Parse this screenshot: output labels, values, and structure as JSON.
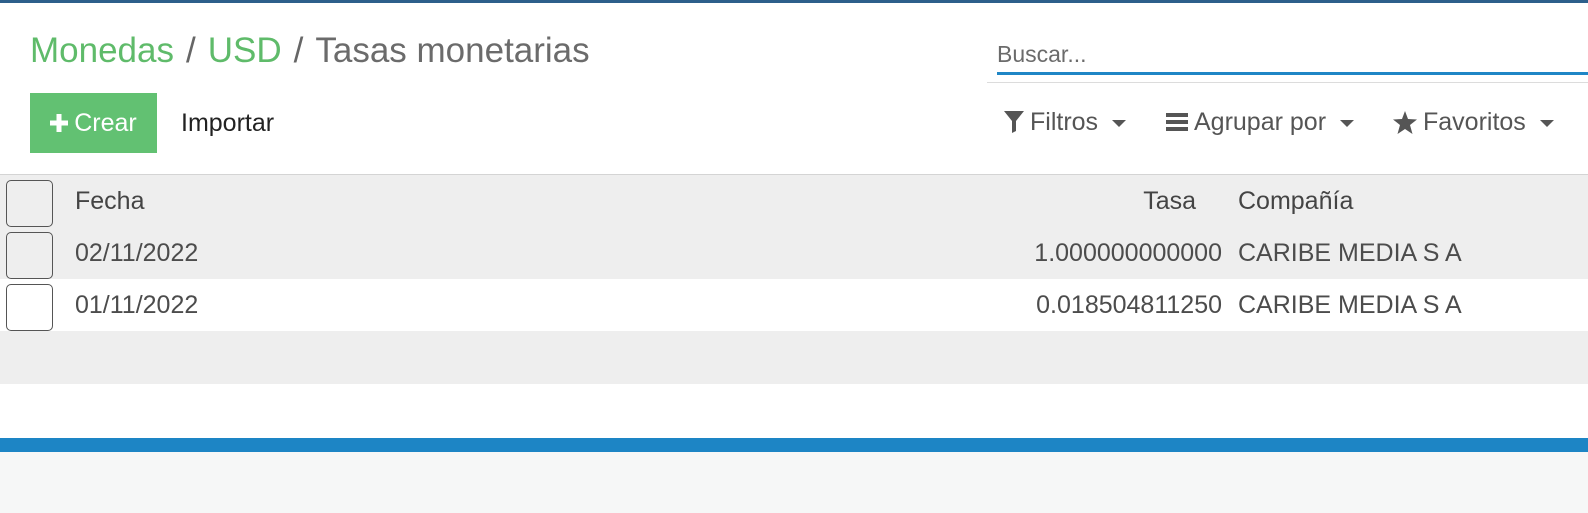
{
  "breadcrumb": {
    "items": [
      "Monedas",
      "USD"
    ],
    "separator": "/",
    "current": "Tasas monetarias"
  },
  "search": {
    "placeholder": "Buscar..."
  },
  "buttons": {
    "create": "Crear",
    "import": "Importar"
  },
  "filters": {
    "filtros": "Filtros",
    "agrupar": "Agrupar por",
    "favoritos": "Favoritos"
  },
  "table": {
    "columns": {
      "fecha": "Fecha",
      "tasa": "Tasa",
      "compania": "Compañía"
    },
    "rows": [
      {
        "fecha": "02/11/2022",
        "tasa": "1.000000000000",
        "compania": "CARIBE MEDIA S A"
      },
      {
        "fecha": "01/11/2022",
        "tasa": "0.018504811250",
        "compania": "CARIBE MEDIA S A"
      }
    ]
  },
  "icons": {
    "create": "plus-icon",
    "filtros": "filter-icon",
    "agrupar": "bars-icon",
    "favoritos": "star-icon"
  },
  "colors": {
    "accent_green": "#62c172",
    "breadcrumb_link": "#5fbb6a",
    "search_underline": "#1f86c6",
    "bottom_bar": "#1d85c5",
    "top_line": "#2d5f8b"
  }
}
